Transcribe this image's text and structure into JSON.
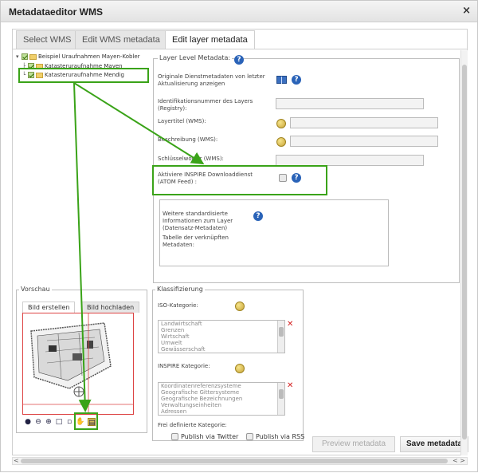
{
  "window": {
    "title": "Metadataeditor WMS",
    "close_label": "×"
  },
  "tabs": [
    {
      "label": "Select WMS",
      "active": false
    },
    {
      "label": "Edit WMS metadata",
      "active": false
    },
    {
      "label": "Edit layer metadata",
      "active": true
    }
  ],
  "tree": {
    "root": "Beispiel Uraufnahmen Mayen-Kobler",
    "children": [
      "Katasteruraufnahme Mayen",
      "Katasteruraufnahme Mendig"
    ]
  },
  "layer_metadata": {
    "legend": "Layer Level Metadata:",
    "original_services_label": "Originale Dienstmetadaten von letzter Aktualisierung anzeigen",
    "id_label": "Identifikationsnummer des Layers (Registry):",
    "title_label": "Layertitel (WMS):",
    "description_label": "Beschreibung (WMS):",
    "keywords_label": "Schlüsselwörter (WMS):",
    "inspire_label": "Aktiviere INSPIRE Downloaddienst (ATOM Feed) :",
    "further_info_label": "Weitere standardisierte Informationen zum Layer (Datensatz-Metadaten)",
    "table_label": "Tabelle der verknüpften Metadaten:"
  },
  "preview": {
    "legend": "Vorschau",
    "tab_create": "Bild erstellen",
    "tab_upload": "Bild hochladen"
  },
  "classification": {
    "legend": "Klassifizierung",
    "iso_label": "ISO-Kategorie:",
    "iso_items": [
      "Landwirtschaft",
      "Grenzen",
      "Wirtschaft",
      "Umwelt",
      "Gewässerschaft"
    ],
    "inspire_label": "INSPIRE Kategorie:",
    "inspire_items": [
      "Koordinatenreferenzsysteme",
      "Geografische Gittersysteme",
      "Geografische Bezeichnungen",
      "Verwaltungseinheiten",
      "Adressen"
    ],
    "free_label": "Frei definierte Kategorie:"
  },
  "footer": {
    "twitter_label": "Publish via Twitter",
    "rss_label": "Publish via RSS",
    "preview_button": "Preview metadata",
    "save_button": "Save metadata"
  },
  "scrollbar": {
    "left_arrow": "<",
    "right_arrow": "< >"
  },
  "colors": {
    "highlight": "#3aa318",
    "help": "#2a63b8",
    "delete": "#d42020"
  },
  "icons": [
    "help-icon",
    "book-icon",
    "globe-icon",
    "delete-icon",
    "zoom-in-icon",
    "zoom-out-icon",
    "pan-icon",
    "save-image-icon"
  ]
}
